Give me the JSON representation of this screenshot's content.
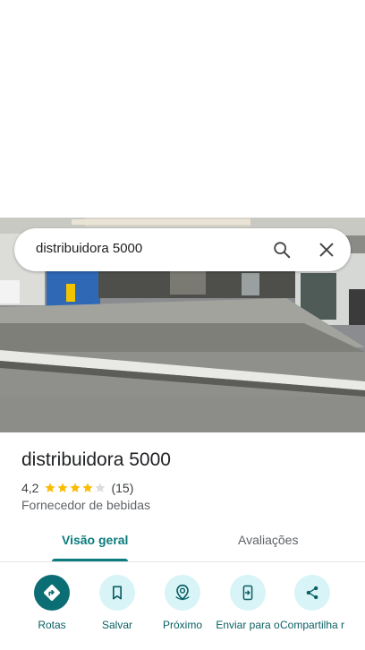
{
  "search": {
    "query": "distribuidora 5000"
  },
  "place": {
    "title": "distribuidora 5000",
    "rating": "4,2",
    "stars_value": 4.2,
    "stars_max": 5,
    "review_count": "(15)",
    "category": "Fornecedor de bebidas"
  },
  "tabs": [
    {
      "label": "Visão geral",
      "active": true
    },
    {
      "label": "Avaliações",
      "active": false
    }
  ],
  "actions": [
    {
      "label": "Rotas",
      "icon": "directions-icon"
    },
    {
      "label": "Salvar",
      "icon": "bookmark-icon"
    },
    {
      "label": "Próximo",
      "icon": "nearby-icon"
    },
    {
      "label": "Enviar para o",
      "icon": "send-to-phone-icon"
    },
    {
      "label": "Compartilha r",
      "icon": "share-icon"
    }
  ],
  "colors": {
    "accent": "#0b7b7e",
    "primary_button": "#0b6e74",
    "action_bg": "#d8f4f6",
    "star": "#fbbc04"
  }
}
